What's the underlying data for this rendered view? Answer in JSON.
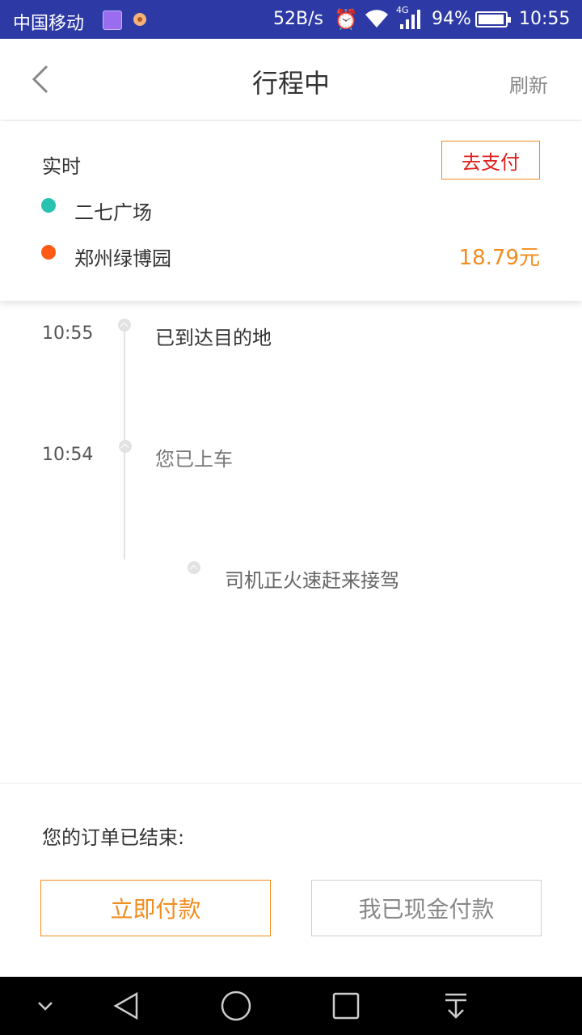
{
  "status_bar": {
    "carrier": "中国移动",
    "net_speed": "52B/s",
    "network_type": "4G",
    "battery": "94%",
    "time": "10:55"
  },
  "header": {
    "title": "行程中",
    "refresh_label": "刷新",
    "back_icon": "chevron-left-icon"
  },
  "trip": {
    "type": "实时",
    "pay_button": "去支付",
    "start": "二七广场",
    "end": "郑州绿博园",
    "price": "18.79元",
    "colors": {
      "start_dot": "#27c2b0",
      "end_dot": "#ff5a13",
      "accent": "#f28c1e",
      "pay_text": "#e0201c"
    }
  },
  "timeline": [
    {
      "time": "10:55",
      "text": "已到达目的地"
    },
    {
      "time": "10:54",
      "text": "您已上车"
    },
    {
      "time": "",
      "text": "司机正火速赶来接驾"
    }
  ],
  "order": {
    "message": "您的订单已结束:",
    "pay_now": "立即付款",
    "paid_cash": "我已现金付款"
  }
}
